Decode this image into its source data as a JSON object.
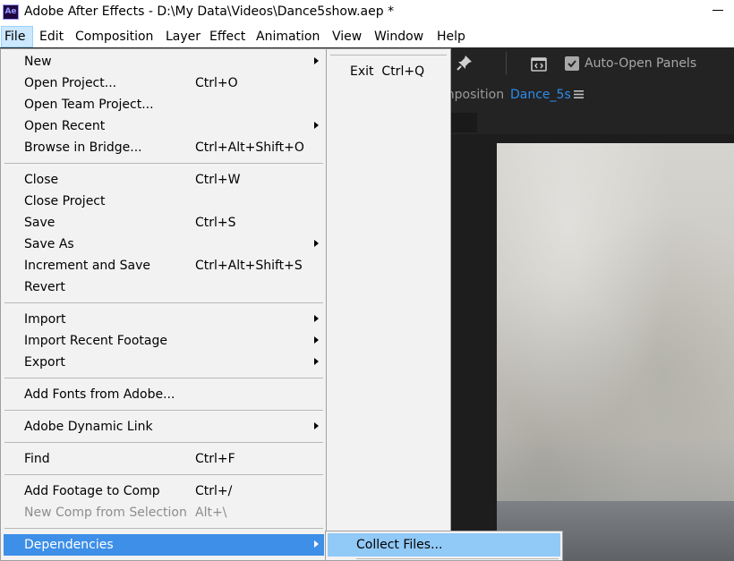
{
  "window": {
    "app_logo_text": "Ae",
    "title": "Adobe After Effects - D:\\My Data\\Videos\\Dance5show.aep *"
  },
  "menubar": {
    "items": [
      "File",
      "Edit",
      "Composition",
      "Layer",
      "Effect",
      "Animation",
      "View",
      "Window",
      "Help"
    ],
    "active": "File"
  },
  "file_menu": {
    "items": [
      {
        "label": "New",
        "shortcut": "",
        "submenu": true
      },
      {
        "label": "Open Project...",
        "shortcut": "Ctrl+O"
      },
      {
        "label": "Open Team Project...",
        "shortcut": ""
      },
      {
        "label": "Open Recent",
        "shortcut": "",
        "submenu": true
      },
      {
        "label": "Browse in Bridge...",
        "shortcut": "Ctrl+Alt+Shift+O"
      },
      {
        "label": "Close",
        "shortcut": "Ctrl+W"
      },
      {
        "label": "Close Project",
        "shortcut": ""
      },
      {
        "label": "Save",
        "shortcut": "Ctrl+S"
      },
      {
        "label": "Save As",
        "shortcut": "",
        "submenu": true
      },
      {
        "label": "Increment and Save",
        "shortcut": "Ctrl+Alt+Shift+S"
      },
      {
        "label": "Revert",
        "shortcut": ""
      },
      {
        "label": "Import",
        "shortcut": "",
        "submenu": true
      },
      {
        "label": "Import Recent Footage",
        "shortcut": "",
        "submenu": true
      },
      {
        "label": "Export",
        "shortcut": "",
        "submenu": true
      },
      {
        "label": "Add Fonts from Adobe...",
        "shortcut": ""
      },
      {
        "label": "Adobe Dynamic Link",
        "shortcut": "",
        "submenu": true
      },
      {
        "label": "Find",
        "shortcut": "Ctrl+F"
      },
      {
        "label": "Add Footage to Comp",
        "shortcut": "Ctrl+/"
      },
      {
        "label": "New Comp from Selection",
        "shortcut": "Alt+\\",
        "disabled": true
      },
      {
        "label": "Dependencies",
        "shortcut": "",
        "submenu": true,
        "highlighted": true
      }
    ]
  },
  "exit_menu": {
    "label": "Exit",
    "shortcut": "Ctrl+Q"
  },
  "dependencies_submenu": {
    "items": [
      {
        "label": "Collect Files...",
        "highlighted": true
      }
    ]
  },
  "toolbar": {
    "auto_open_panels_label": "Auto-Open Panels",
    "auto_open_panels_checked": true
  },
  "composition_panel": {
    "title_prefix": "mposition",
    "comp_name": "Dance_5s"
  },
  "colors": {
    "highlight": "#3d8fe8",
    "submenu_highlight": "#91c9f7",
    "comp_name": "#2d8ceb"
  }
}
